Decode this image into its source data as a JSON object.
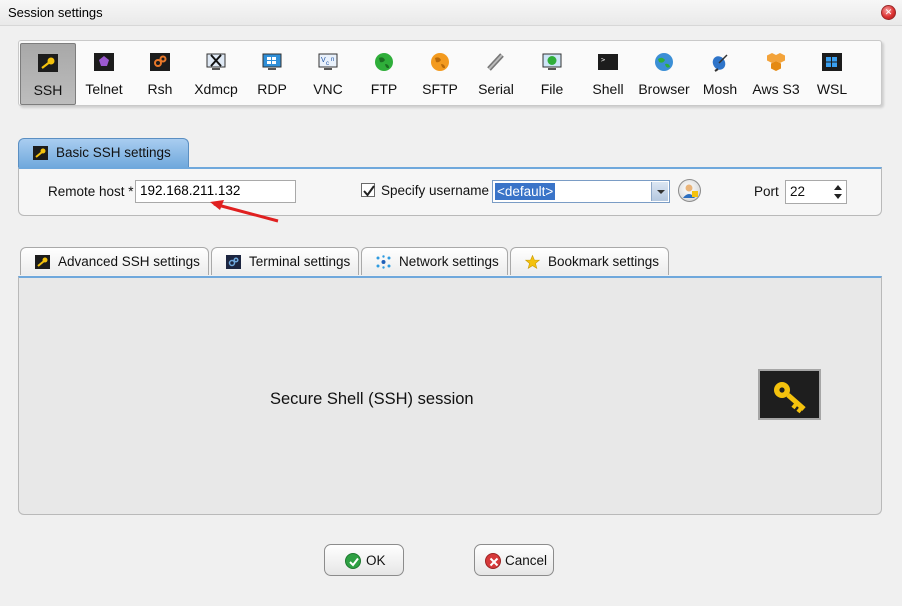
{
  "window": {
    "title": "Session settings"
  },
  "session_types": [
    {
      "label": "SSH",
      "icon": "ssh-key-icon",
      "selected": true
    },
    {
      "label": "Telnet",
      "icon": "telnet-icon"
    },
    {
      "label": "Rsh",
      "icon": "rsh-icon"
    },
    {
      "label": "Xdmcp",
      "icon": "xdmcp-icon"
    },
    {
      "label": "RDP",
      "icon": "rdp-monitor-icon"
    },
    {
      "label": "VNC",
      "icon": "vnc-monitor-icon"
    },
    {
      "label": "FTP",
      "icon": "ftp-globe-icon"
    },
    {
      "label": "SFTP",
      "icon": "sftp-globe-icon"
    },
    {
      "label": "Serial",
      "icon": "serial-plug-icon"
    },
    {
      "label": "File",
      "icon": "file-monitor-icon"
    },
    {
      "label": "Shell",
      "icon": "shell-terminal-icon"
    },
    {
      "label": "Browser",
      "icon": "browser-globe-icon"
    },
    {
      "label": "Mosh",
      "icon": "mosh-satellite-icon"
    },
    {
      "label": "Aws S3",
      "icon": "aws-s3-icon"
    },
    {
      "label": "WSL",
      "icon": "wsl-windows-icon"
    }
  ],
  "basic": {
    "tab_label": "Basic SSH settings",
    "remote_host_label": "Remote host *",
    "remote_host_value": "192.168.211.132",
    "specify_username_label": "Specify username",
    "specify_username_checked": true,
    "username_value": "<default>",
    "port_label": "Port",
    "port_value": "22"
  },
  "lower_tabs": [
    {
      "label": "Advanced SSH settings",
      "icon": "wrench-key-icon"
    },
    {
      "label": "Terminal settings",
      "icon": "terminal-icon"
    },
    {
      "label": "Network settings",
      "icon": "network-icon"
    },
    {
      "label": "Bookmark settings",
      "icon": "star-icon"
    }
  ],
  "panel": {
    "description": "Secure Shell (SSH) session"
  },
  "buttons": {
    "ok": "OK",
    "cancel": "Cancel"
  },
  "colors": {
    "accent": "#6fa8dc",
    "selected_tool": "#a8a8a8",
    "annotation_arrow": "#e02020"
  }
}
